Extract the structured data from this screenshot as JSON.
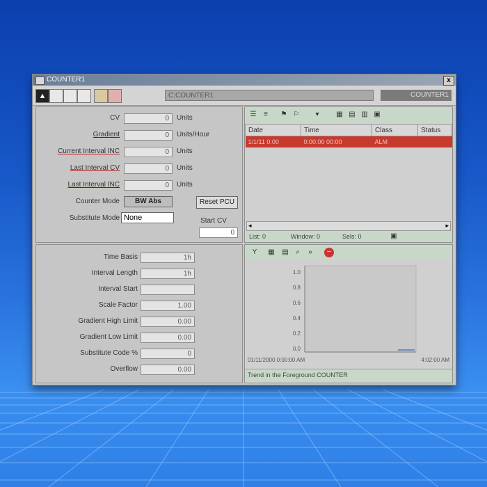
{
  "window": {
    "title": "COUNTER1",
    "close_glyph": "x"
  },
  "toolbar": {
    "device_path": "C:COUNTER1",
    "device_name": "COUNTER1",
    "first_btn": "▲"
  },
  "settings_top": {
    "rows": [
      {
        "label": "CV",
        "value": "0",
        "unit": "Units"
      },
      {
        "label": "Gradient",
        "value": "0",
        "unit": "Units/Hour"
      },
      {
        "label": "Current Interval INC",
        "value": "0",
        "unit": "Units"
      },
      {
        "label": "Last Interval CV",
        "value": "0",
        "unit": "Units"
      },
      {
        "label": "Last Interval INC",
        "value": "0",
        "unit": "Units"
      }
    ],
    "counter_mode_label": "Counter Mode",
    "counter_mode_value": "BW Abs",
    "reset_button": "Reset PCU",
    "substitute_mode_label": "Substitute Mode",
    "substitute_mode_value": "None",
    "start_cv_label": "Start CV",
    "start_cv_value": "0"
  },
  "settings_bottom": {
    "rows": [
      {
        "label": "Time Basis",
        "value": "1h"
      },
      {
        "label": "Interval Length",
        "value": "1h"
      },
      {
        "label": "Interval Start",
        "value": ""
      },
      {
        "label": "Scale Factor",
        "value": "1.00"
      },
      {
        "label": "Gradient High Limit",
        "value": "0.00"
      },
      {
        "label": "Gradient Low Limit",
        "value": "0.00"
      },
      {
        "label": "Substitute Code %",
        "value": "0"
      },
      {
        "label": "Overflow",
        "value": "0.00"
      }
    ]
  },
  "events": {
    "columns": [
      "Date",
      "Time",
      "Class",
      "Status"
    ],
    "rows": [
      {
        "date": "1/1/11 0:00",
        "time": "0:00:00 00:00",
        "class": "ALM",
        "status": ""
      }
    ],
    "status": {
      "list": "List: 0",
      "window": "Window: 0",
      "sels": "Sels: 0"
    }
  },
  "trend": {
    "y_ticks": [
      "1.0",
      "0.8",
      "0.6",
      "0.4",
      "0.2",
      "0.0"
    ],
    "x_start": "01/11/2000 0:00:00 AM",
    "x_end": "4:02:00 AM",
    "caption": "Trend in the Foreground COUNTER"
  },
  "colors": {
    "accent_red": "#c73a2e",
    "chart_bg": "#c9c9c9"
  }
}
